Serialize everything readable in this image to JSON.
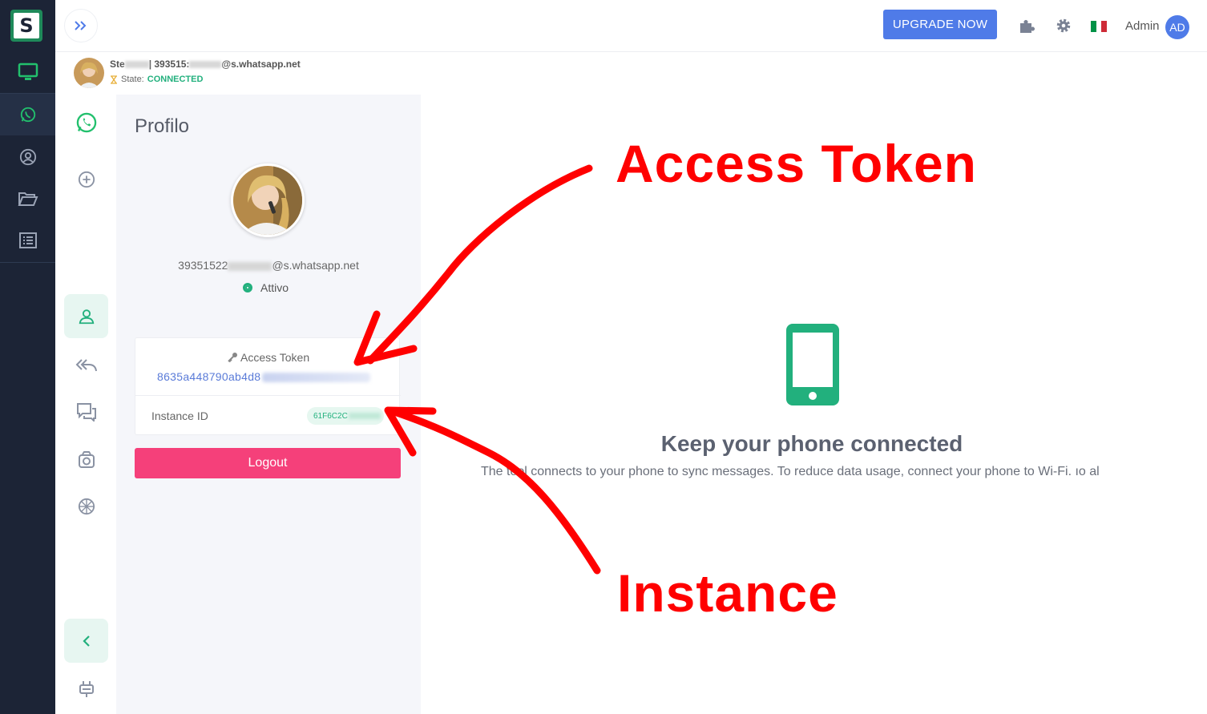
{
  "topbar": {
    "upgrade_label": "UPGRADE NOW",
    "admin_label": "Admin",
    "avatar_initials": "AD",
    "flag_colors": [
      "#009246",
      "#ffffff",
      "#ce2b37"
    ]
  },
  "session": {
    "name_prefix": "Ste",
    "name_mid": "| 393515:",
    "jid_suffix": "@s.whatsapp.net",
    "state_label": "State:",
    "state_value": "CONNECTED"
  },
  "profile": {
    "title": "Profilo",
    "jid_prefix": "39351522",
    "jid_suffix": "@s.whatsapp.net",
    "status": "Attivo",
    "access_token_label": "Access Token",
    "access_token_value": "8635a448790ab4d8",
    "instance_id_label": "Instance ID",
    "instance_id_value": "61F6C2C",
    "logout_label": "Logout"
  },
  "main": {
    "title": "Keep your phone connected",
    "description": "The tool connects to your phone to sync messages. To reduce data usage, connect your phone to Wi-Fi. ıo al"
  },
  "annotations": {
    "token": "Access Token",
    "instance": "Instance"
  },
  "colors": {
    "accent_green": "#22b07d",
    "primary_blue": "#4f7be8",
    "logout_pink": "#f5407a",
    "annotation_red": "#ff0000",
    "rail_bg": "#1c2436"
  },
  "icons": {
    "rail": [
      "logo-icon",
      "monitor-icon",
      "whatsapp-icon",
      "user-circle-icon",
      "folder-open-icon",
      "list-icon"
    ],
    "subnav": [
      "whatsapp-icon",
      "plus-circle-icon",
      "user-icon",
      "reply-all-icon",
      "chat-icon",
      "camera-icon",
      "sticker-icon",
      "chevron-left-icon",
      "plug-icon"
    ],
    "topbar": [
      "double-chevron-right-icon",
      "puzzle-icon",
      "gear-icon",
      "italy-flag-icon"
    ]
  }
}
